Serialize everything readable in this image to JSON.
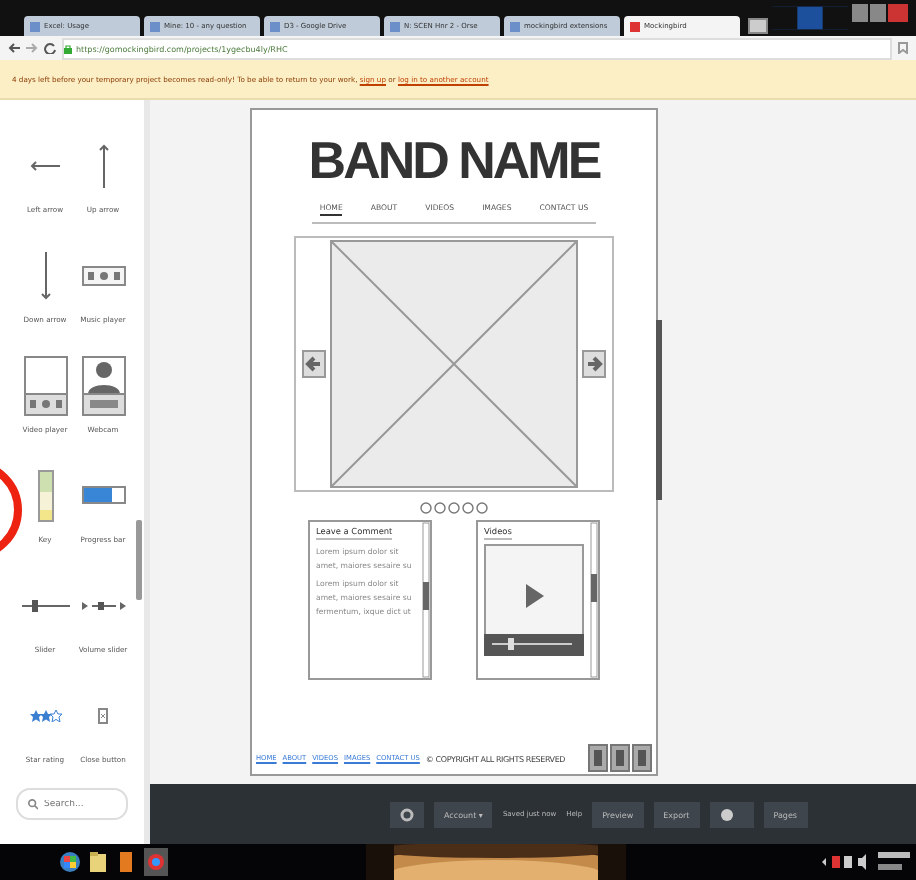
{
  "browser": {
    "tabs": [
      {
        "label": "Excel: Usage",
        "selected": false
      },
      {
        "label": "Mine: 10 - any question",
        "selected": false
      },
      {
        "label": "D3 - Google Drive",
        "selected": false
      },
      {
        "label": "N: SCEN Hnr 2 - Orse",
        "selected": false
      },
      {
        "label": "mockingbird extensions",
        "selected": false
      },
      {
        "label": "Mockingbird",
        "selected": true
      }
    ],
    "url": "https://gomockingbird.com/projects/1ygecbu4ly/RHC",
    "banner": [
      {
        "kind": "text",
        "text": "4 days left before your temporary project becomes read-only! To be able to return to your work, "
      },
      {
        "kind": "link",
        "text": "sign up"
      },
      {
        "kind": "text",
        "text": " or "
      },
      {
        "kind": "link",
        "text": "log in to another account"
      }
    ]
  },
  "palette": {
    "items": [
      {
        "kind": "left-arrow",
        "label": "Left arrow"
      },
      {
        "kind": "up-arrow",
        "label": "Up arrow"
      },
      {
        "kind": "down-arrow",
        "label": "Down arrow"
      },
      {
        "kind": "music-player",
        "label": "Music player"
      },
      {
        "kind": "video-player",
        "label": "Video player"
      },
      {
        "kind": "webcam",
        "label": "Webcam"
      },
      {
        "kind": "key",
        "label": "Key"
      },
      {
        "kind": "progress-bar",
        "label": "Progress bar"
      },
      {
        "kind": "slider",
        "label": "Slider"
      },
      {
        "kind": "volume-slider",
        "label": "Volume slider"
      },
      {
        "kind": "star-rating",
        "label": "Star rating"
      },
      {
        "kind": "close-button",
        "label": "Close button"
      }
    ],
    "search": {
      "placeholder": "Search..."
    }
  },
  "wireframe": {
    "title": "BAND NAME",
    "nav": [
      {
        "label": "HOME",
        "selected": true
      },
      {
        "label": "ABOUT",
        "selected": false
      },
      {
        "label": "VIDEOS",
        "selected": false
      },
      {
        "label": "IMAGES",
        "selected": false
      },
      {
        "label": "CONTACT US",
        "selected": false
      }
    ],
    "comment_box": {
      "title": "Leave a Comment",
      "paragraphs": [
        "Lorem ipsum dolor sit amet, maiores sesaire su",
        "Lorem ipsum dolor sit amet, maiores sesaire su fermentum, ixque dict ut"
      ]
    },
    "videos_box": {
      "title": "Videos"
    },
    "footer": {
      "links": [
        "HOME",
        "ABOUT",
        "VIDEOS",
        "IMAGES",
        "CONTACT US"
      ],
      "copyright": "© COPYRIGHT ALL RIGHTS RESERVED"
    }
  },
  "toolbar": [
    {
      "kind": "settings"
    },
    {
      "kind": "menu",
      "label": "Account ▾"
    },
    {
      "kind": "status",
      "label": "Saved just now"
    },
    {
      "kind": "link",
      "label": "Help"
    },
    {
      "kind": "button",
      "label": "Preview"
    },
    {
      "kind": "button",
      "label": "Export"
    },
    {
      "kind": "zoom"
    },
    {
      "kind": "button",
      "label": "Pages"
    }
  ]
}
